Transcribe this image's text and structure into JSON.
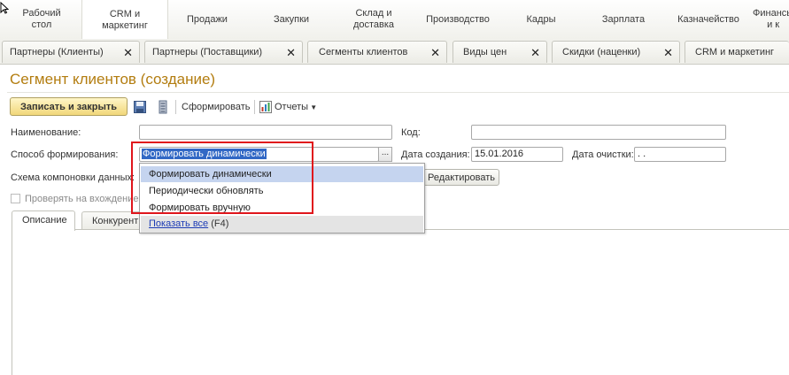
{
  "top_menu": {
    "items": [
      "Рабочий\nстол",
      "CRM и\nмаркетинг",
      "Продажи",
      "Закупки",
      "Склад и\nдоставка",
      "Производство",
      "Кадры",
      "Зарплата",
      "Казначейство",
      "Финансы\nи к"
    ]
  },
  "window_tabs": [
    "Партнеры (Клиенты)",
    "Партнеры (Поставщики)",
    "Сегменты клиентов",
    "Виды цен",
    "Скидки (наценки)",
    "CRM и маркетинг"
  ],
  "form": {
    "title": "Сегмент клиентов (создание)",
    "toolbar": {
      "save_close": "Записать и закрыть",
      "generate": "Сформировать",
      "reports": "Отчеты"
    },
    "fields": {
      "name_label": "Наименование:",
      "name_value": "",
      "code_label": "Код:",
      "code_value": "",
      "method_label": "Способ формирования:",
      "method_value": "Формировать динамически",
      "created_label": "Дата создания:",
      "created_value": "15.01.2016",
      "clear_label": "Дата очистки:",
      "clear_value": " .  .",
      "schema_label": "Схема компоновки данных:",
      "edit_button": "Редактировать",
      "check_label": "Проверять на вхождение"
    },
    "inner_tabs": [
      "Описание",
      "Конкурент"
    ],
    "dropdown": {
      "options": [
        "Формировать динамически",
        "Периодически обновлять",
        "Формировать вручную"
      ],
      "show_all_link": "Показать все",
      "show_all_hint": "(F4)"
    }
  },
  "colors": {
    "title": "#b37d10",
    "highlight": "#c5d4ef",
    "selection": "#3168c5",
    "annotation": "#e0161c"
  }
}
